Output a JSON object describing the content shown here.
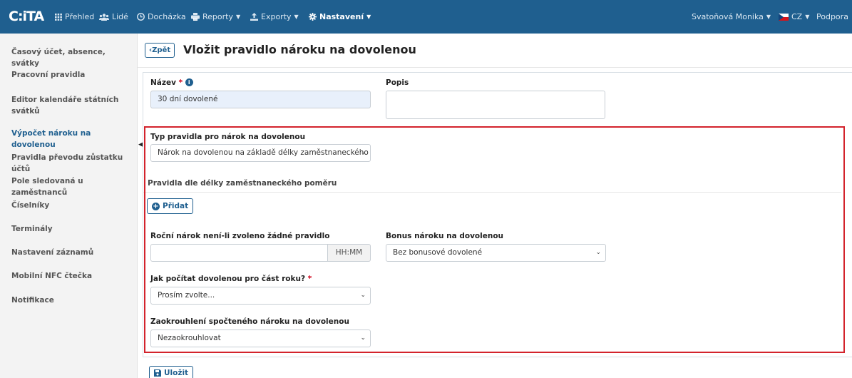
{
  "nav": {
    "logo": "C:iTA",
    "items": [
      {
        "label": "Přehled",
        "icon": "grid-icon"
      },
      {
        "label": "Lidé",
        "icon": "users-icon"
      },
      {
        "label": "Docházka",
        "icon": "clock-icon"
      },
      {
        "label": "Reporty",
        "icon": "print-icon"
      },
      {
        "label": "Exporty",
        "icon": "export-icon"
      },
      {
        "label": "Nastavení",
        "icon": "gear-icon"
      }
    ],
    "user": "Svatoňová Monika",
    "language": "CZ",
    "support": "Podpora"
  },
  "sidebar": {
    "items": [
      {
        "label": "Časový účet, absence, svátky"
      },
      {
        "label": "Pracovní pravidla"
      },
      {
        "label": "Editor kalendáře státních svátků"
      },
      {
        "label": "Výpočet nároku na dovolenou",
        "active": true
      },
      {
        "label": "Pravidla převodu zůstatku účtů"
      },
      {
        "label": "Pole sledovaná u zaměstnanců"
      },
      {
        "label": "Číselníky"
      },
      {
        "label": "Terminály"
      },
      {
        "label": "Nastavení záznamů"
      },
      {
        "label": "Mobilní NFC čtečka"
      },
      {
        "label": "Notifikace"
      }
    ]
  },
  "header": {
    "back_label": "Zpět",
    "title": "Vložit pravidlo nároku na dovolenou"
  },
  "form": {
    "name_label": "Název",
    "name_value": "30 dní dovolené",
    "description_label": "Popis",
    "description_value": "",
    "rule_type_label": "Typ pravidla pro nárok na dovolenou",
    "rule_type_value": "Nárok na dovolenou na základě délky zaměstnaneckého poměru",
    "section_title": "Pravidla dle délky zaměstnaneckého poměru",
    "add_label": "Přidat",
    "annual_label": "Roční nárok není-li zvoleno žádné pravidlo",
    "annual_value": "",
    "annual_unit": "HH:MM",
    "bonus_label": "Bonus nároku na dovolenou",
    "bonus_value": "Bez bonusové dovolené",
    "partial_label": "Jak počítat dovolenou pro část roku?",
    "partial_value": "Prosím zvolte...",
    "rounding_label": "Zaokrouhlení spočteného nároku na dovolenou",
    "rounding_value": "Nezaokrouhlovat",
    "save_label": "Uložit"
  },
  "colors": {
    "navbar": "#1f5f8f",
    "accent": "#1f5f8f",
    "required": "#d0021b",
    "highlight_box": "#d3232c",
    "filled_input": "#e8f0fb"
  }
}
